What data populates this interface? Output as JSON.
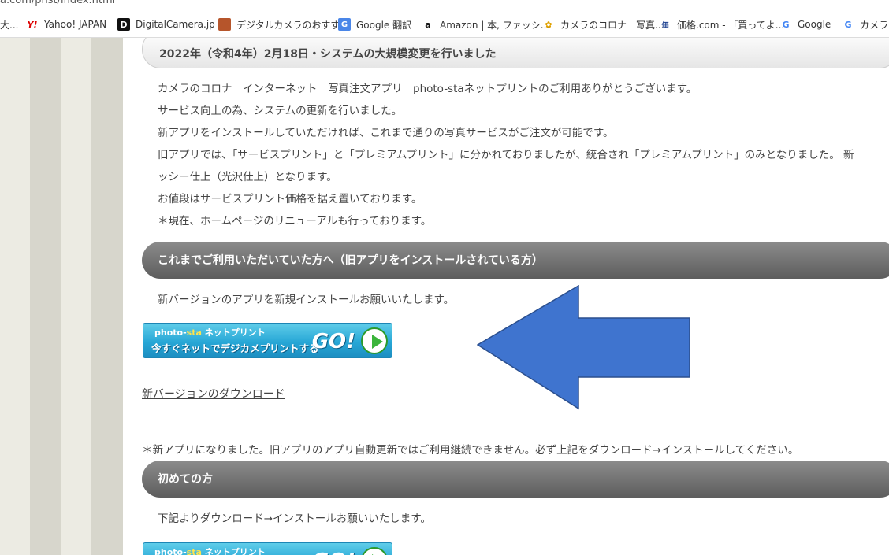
{
  "browser": {
    "url_fragment": "a.com/pnst/index.html",
    "bookmarks": [
      {
        "label": "大...",
        "icon": "folder-icon"
      },
      {
        "label": "Yahoo! JAPAN",
        "icon": "yahoo-icon"
      },
      {
        "label": "DigitalCamera.jp",
        "icon": "digitalcamera-icon"
      },
      {
        "label": "デジタルカメラのおすす...",
        "icon": "site-icon"
      },
      {
        "label": "Google 翻訳",
        "icon": "google-translate-icon"
      },
      {
        "label": "Amazon | 本, ファッシ...",
        "icon": "amazon-icon"
      },
      {
        "label": "カメラのコロナ　写真...",
        "icon": "flower-icon"
      },
      {
        "label": "価格.com - 「買ってよ...",
        "icon": "kakaku-icon"
      },
      {
        "label": "Google",
        "icon": "google-icon"
      },
      {
        "label": "カメラの",
        "icon": "google-icon"
      }
    ]
  },
  "main": {
    "top_heading": "2022年（令和4年）2月18日・システムの大規模変更を行いました",
    "intro_lines": [
      "カメラのコロナ　インターネット　写真注文アプリ　photo-staネットプリントのご利用ありがとうございます。",
      "サービス向上の為、システムの更新を行いました。",
      "新アプリをインストールしていただければ、これまで通りの写真サービスがご注文が可能です。",
      "旧アプリでは、「サービスプリント」と「プレミアムプリント」に分かれておりましたが、統合され「プレミアムプリント」のみとなりました。 新",
      "ッシー仕上（光沢仕上）となります。",
      "お値段はサービスプリント価格を据え置いております。",
      "＊現在、ホームページのリニューアルも行っております。"
    ],
    "section_existing": {
      "heading": "これまでご利用いただいていた方へ（旧アプリをインストールされている方）",
      "text": "新バージョンのアプリを新規インストールお願いいたします。",
      "download_link": "新バージョンのダウンロード",
      "note": "＊新アプリになりました。旧アプリのアプリ自動更新ではご利用継続できません。必ず上記をダウンロード→インストールしてください。"
    },
    "section_new": {
      "heading": "初めての方",
      "text": "下記よりダウンロード→インストールお願いいたします。"
    },
    "banner": {
      "logo_prefix": "photo-",
      "logo_sta": "sta",
      "logo_suffix": " ネットプリント",
      "subtitle": "今すぐネットでデジカメプリントする",
      "go": "GO!"
    }
  },
  "colors": {
    "arrow_fill": "#3f74cf",
    "arrow_stroke": "#2b4f8e",
    "dark_bar": "#6f6f6f",
    "banner_blue": "#27a7d6"
  }
}
